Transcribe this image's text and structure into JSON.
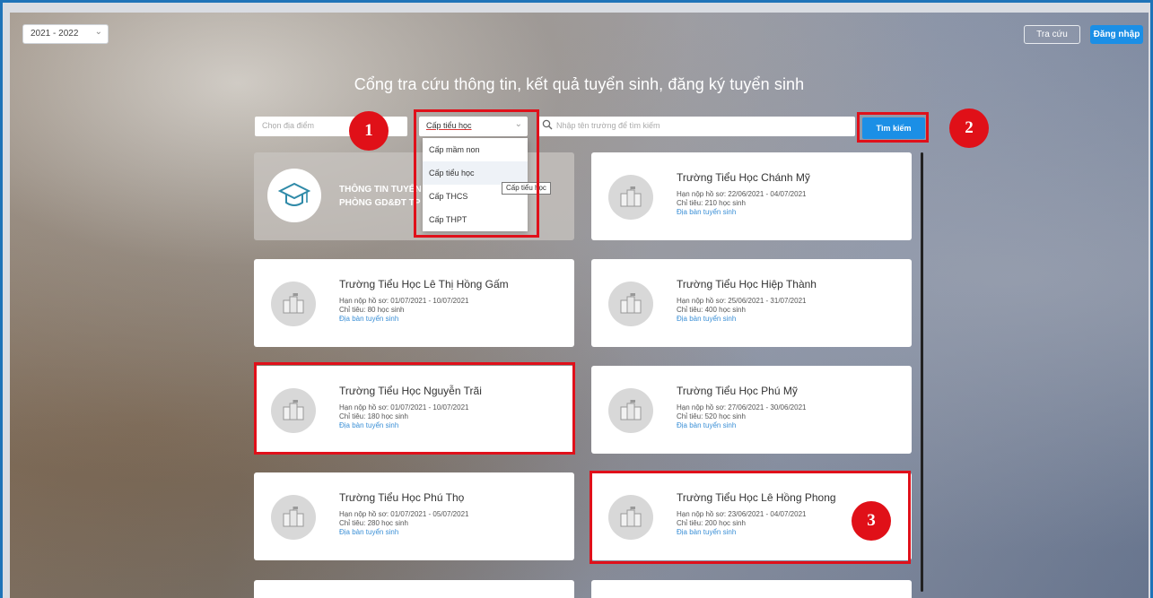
{
  "top_bar": {
    "year_selected": "2021 - 2022",
    "lookup_label": "Tra cứu",
    "login_label": "Đăng nhập"
  },
  "page_title": "Cổng tra cứu thông tin, kết quả tuyển sinh, đăng ký tuyển sinh",
  "search": {
    "location_placeholder": "Chọn địa điểm",
    "level_selected": "Cấp tiểu học",
    "name_placeholder": "Nhập tên trường để tìm kiếm",
    "search_button": "Tìm kiếm"
  },
  "level_dropdown": {
    "options": [
      "Cấp mầm non",
      "Cấp tiểu học",
      "Cấp THCS",
      "Cấp THPT"
    ],
    "tooltip": "Cấp tiểu học"
  },
  "dept_card": {
    "line1": "THÔNG TIN TUYỂN",
    "line2": "PHÒNG GD&ĐT TP"
  },
  "schools": [
    {
      "name": "Trường Tiểu Học Chánh Mỹ",
      "deadline": "Hạn nộp hồ sơ: 22/06/2021 - 04/07/2021",
      "quota": "Chỉ tiêu: 210 học sinh",
      "link": "Địa bàn tuyển sinh"
    },
    {
      "name": "Trường Tiểu Học Lê Thị Hồng Gấm",
      "deadline": "Hạn nộp hồ sơ: 01/07/2021 - 10/07/2021",
      "quota": "Chỉ tiêu: 80 học sinh",
      "link": "Địa bàn tuyển sinh"
    },
    {
      "name": "Trường Tiểu Học Hiệp Thành",
      "deadline": "Hạn nộp hồ sơ: 25/06/2021 - 31/07/2021",
      "quota": "Chỉ tiêu: 400 học sinh",
      "link": "Địa bàn tuyển sinh"
    },
    {
      "name": "Trường Tiểu Học Nguyễn Trãi",
      "deadline": "Hạn nộp hồ sơ: 01/07/2021 - 10/07/2021",
      "quota": "Chỉ tiêu: 180 học sinh",
      "link": "Địa bàn tuyển sinh"
    },
    {
      "name": "Trường Tiểu Học Phú Mỹ",
      "deadline": "Hạn nộp hồ sơ: 27/06/2021 - 30/06/2021",
      "quota": "Chỉ tiêu: 520 học sinh",
      "link": "Địa bàn tuyển sinh"
    },
    {
      "name": "Trường Tiểu Học Phú Thọ",
      "deadline": "Hạn nộp hồ sơ: 01/07/2021 - 05/07/2021",
      "quota": "Chỉ tiêu: 280 học sinh",
      "link": "Địa bàn tuyển sinh"
    },
    {
      "name": "Trường Tiểu Học Lê Hồng Phong",
      "deadline": "Hạn nộp hồ sơ: 23/06/2021 - 04/07/2021",
      "quota": "Chỉ tiêu: 200 học sinh",
      "link": "Địa bàn tuyển sinh"
    }
  ],
  "annotations": [
    "1",
    "2",
    "3"
  ],
  "colors": {
    "accent": "#1b8fe6",
    "highlight": "#e0101a",
    "link": "#3a8fd6"
  }
}
